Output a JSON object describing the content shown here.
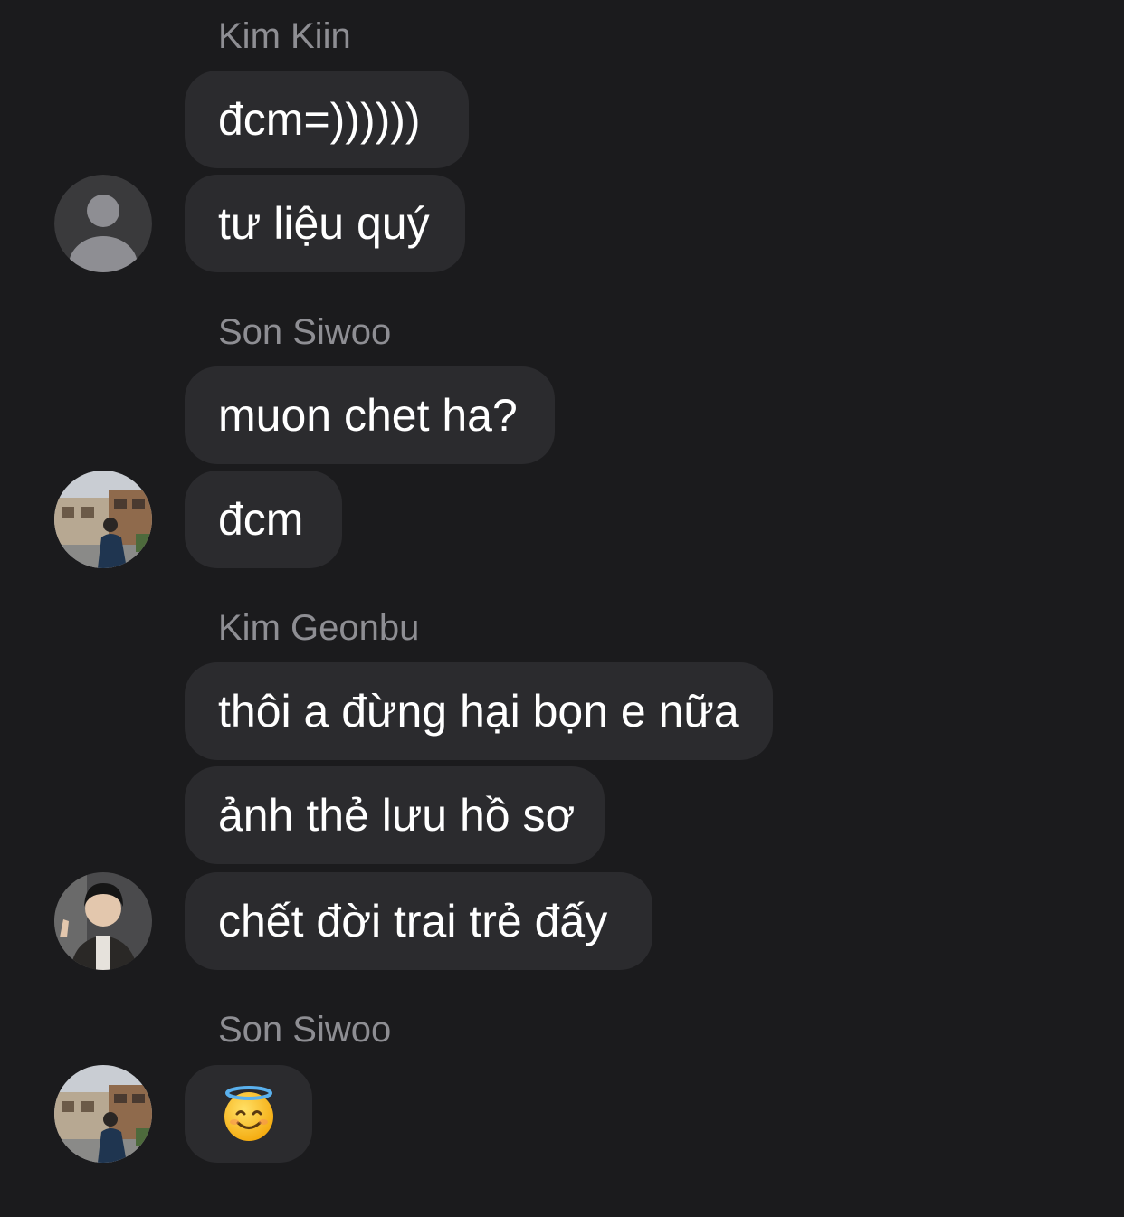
{
  "conversation": {
    "groups": [
      {
        "sender": "Kim Kiin",
        "avatar": "default-person-icon",
        "messages": [
          "đcm=))))))",
          "tư liệu quý"
        ]
      },
      {
        "sender": "Son Siwoo",
        "avatar": "photo-avatar-street",
        "messages": [
          "muon chet ha?",
          "đcm"
        ]
      },
      {
        "sender": "Kim Geonbu",
        "avatar": "photo-avatar-person",
        "messages": [
          "thôi a đừng hại bọn e nữa",
          "ảnh thẻ lưu hồ sơ",
          "chết đời trai trẻ đấy"
        ]
      },
      {
        "sender": "Son Siwoo",
        "avatar": "photo-avatar-street",
        "messages": [
          "smiling-face-with-halo-emoji"
        ]
      }
    ]
  },
  "colors": {
    "background": "#1b1b1d",
    "bubble": "#2b2b2e",
    "sender_name": "#8e8e93",
    "message_text": "#ffffff"
  }
}
